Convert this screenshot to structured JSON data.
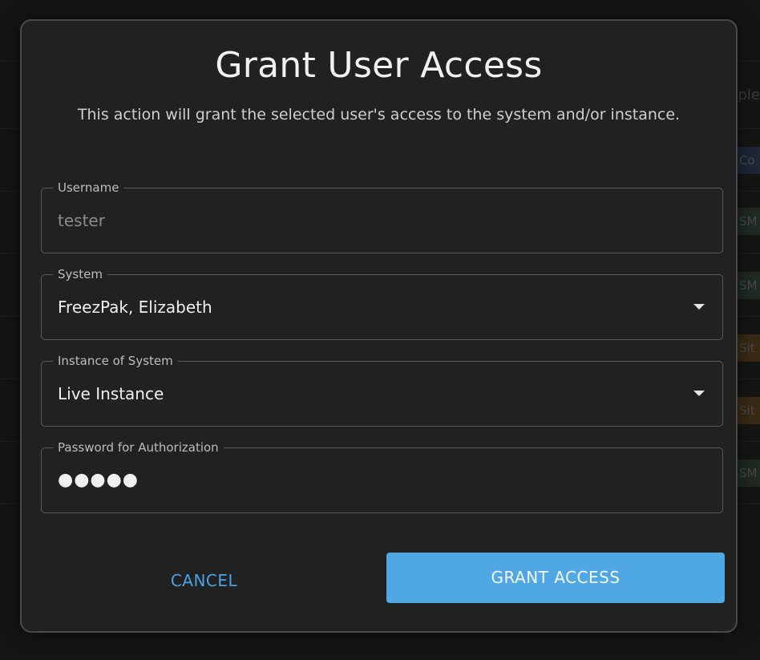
{
  "background": {
    "peek_texts": [
      "ple",
      "Co",
      "SM",
      "SM",
      "Sit",
      "Sit",
      "SM"
    ],
    "chip_colors": [
      "#1e2638",
      "#1f2a22",
      "#1f2a22",
      "#3a2a14",
      "#3a2a14",
      "#1f2a22"
    ]
  },
  "dialog": {
    "title": "Grant User Access",
    "subtitle": "This action will grant the selected user's access to the system and/or instance.",
    "fields": {
      "username": {
        "label": "Username",
        "value": "tester"
      },
      "system": {
        "label": "System",
        "value": "FreezPak, Elizabeth"
      },
      "instance": {
        "label": "Instance of System",
        "value": "Live Instance"
      },
      "password": {
        "label": "Password for Authorization",
        "value": "●●●●●"
      }
    },
    "buttons": {
      "cancel": "CANCEL",
      "grant": "GRANT ACCESS"
    }
  },
  "colors": {
    "accent": "#4fa7e3",
    "modal_bg": "#212121",
    "page_bg": "#151515"
  }
}
